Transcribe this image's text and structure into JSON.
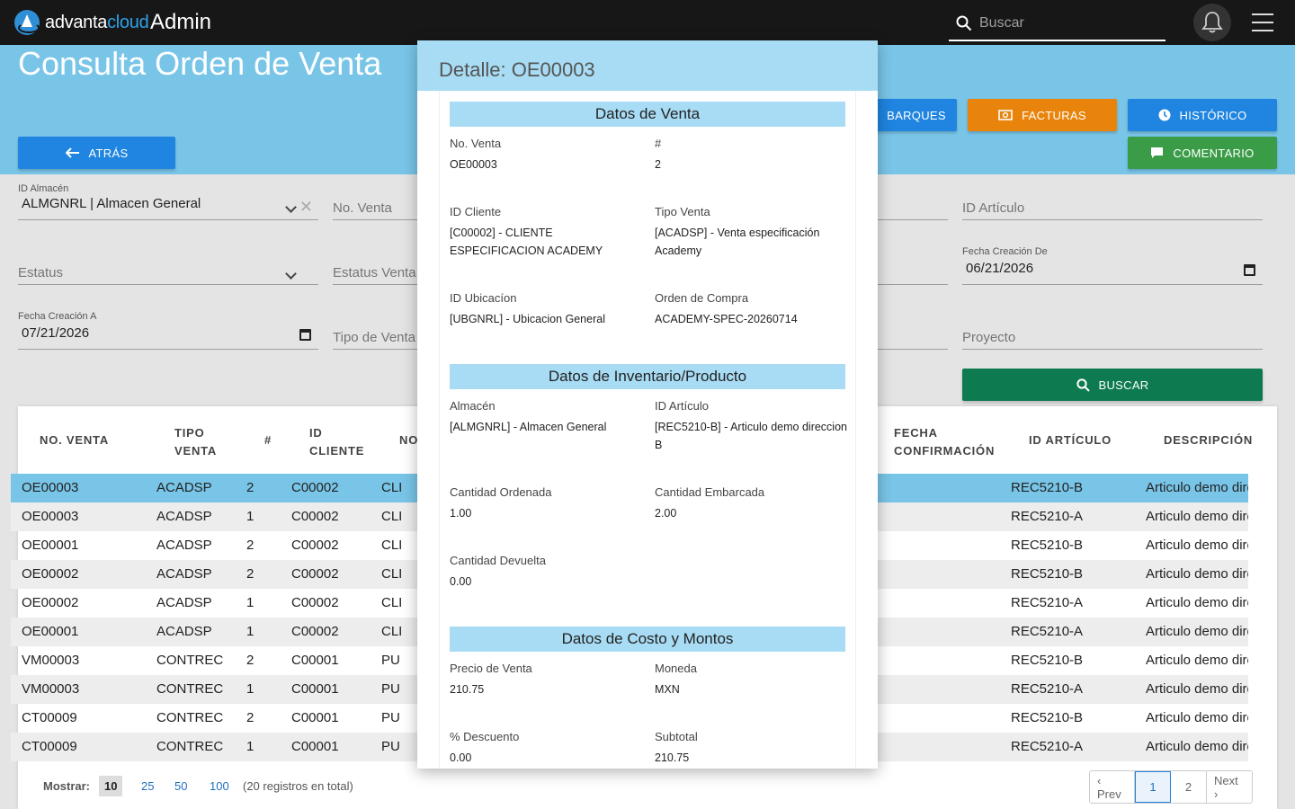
{
  "header": {
    "logo_a": "advanta",
    "logo_b": "cloud",
    "app": "Admin",
    "search_placeholder": "Buscar"
  },
  "page": {
    "title": "Consulta Orden de Venta",
    "back_label": "ATRÁS",
    "embarques_label": "BARQUES",
    "facturas_label": "FACTURAS",
    "historico_label": "HISTÓRICO",
    "comentario_label": "COMENTARIO",
    "buscar_label": "BUSCAR"
  },
  "filters": {
    "almacen_label": "ID Almacén",
    "almacen_value": "ALMGNRL | Almacen General",
    "no_venta": "No. Venta",
    "id_articulo": "ID Artículo",
    "estatus": "Estatus",
    "estatus_venta": "Estatus Venta",
    "fecha_de_label": "Fecha Creación De",
    "fecha_de_value": "06/21/2026",
    "fecha_a_label": "Fecha Creación A",
    "fecha_a_value": "07/21/2026",
    "tipo_venta": "Tipo de Venta",
    "proyecto": "Proyecto"
  },
  "table": {
    "headers": {
      "no_venta": "NO. VENTA",
      "tipo_1": "TIPO",
      "tipo_2": "VENTA",
      "num": "#",
      "cliente_1": "ID",
      "cliente_2": "CLIENTE",
      "no": "NO",
      "fecha_1": "FECHA",
      "fecha_2": "CONFIRMACIÓN",
      "articulo": "ID ARTÍCULO",
      "descripcion": "DESCRIPCIÓN"
    },
    "rows": [
      {
        "venta": "OE00003",
        "tipo": "ACADSP",
        "num": "2",
        "cliente": "C00002",
        "no": "CLI",
        "articulo": "REC5210-B",
        "desc": "Articulo demo direccion B"
      },
      {
        "venta": "OE00003",
        "tipo": "ACADSP",
        "num": "1",
        "cliente": "C00002",
        "no": "CLI",
        "articulo": "REC5210-A",
        "desc": "Articulo demo direccion A"
      },
      {
        "venta": "OE00001",
        "tipo": "ACADSP",
        "num": "2",
        "cliente": "C00002",
        "no": "CLI",
        "articulo": "REC5210-B",
        "desc": "Articulo demo direccion B"
      },
      {
        "venta": "OE00002",
        "tipo": "ACADSP",
        "num": "2",
        "cliente": "C00002",
        "no": "CLI",
        "articulo": "REC5210-B",
        "desc": "Articulo demo direccion B"
      },
      {
        "venta": "OE00002",
        "tipo": "ACADSP",
        "num": "1",
        "cliente": "C00002",
        "no": "CLI",
        "articulo": "REC5210-A",
        "desc": "Articulo demo direccion A"
      },
      {
        "venta": "OE00001",
        "tipo": "ACADSP",
        "num": "1",
        "cliente": "C00002",
        "no": "CLI",
        "articulo": "REC5210-A",
        "desc": "Articulo demo direccion A"
      },
      {
        "venta": "VM00003",
        "tipo": "CONTREC",
        "num": "2",
        "cliente": "C00001",
        "no": "PU",
        "articulo": "REC5210-B",
        "desc": "Articulo demo direccion B"
      },
      {
        "venta": "VM00003",
        "tipo": "CONTREC",
        "num": "1",
        "cliente": "C00001",
        "no": "PU",
        "articulo": "REC5210-A",
        "desc": "Articulo demo direccion A"
      },
      {
        "venta": "CT00009",
        "tipo": "CONTREC",
        "num": "2",
        "cliente": "C00001",
        "no": "PU",
        "articulo": "REC5210-B",
        "desc": "Articulo demo direccion B"
      },
      {
        "venta": "CT00009",
        "tipo": "CONTREC",
        "num": "1",
        "cliente": "C00001",
        "no": "PU",
        "articulo": "REC5210-A",
        "desc": "Articulo demo direccion A"
      }
    ],
    "footer": {
      "mostrar": "Mostrar:",
      "sizes": [
        "10",
        "25",
        "50",
        "100"
      ],
      "total": "(20 registros en total)",
      "prev": "‹ Prev",
      "pages": [
        "1",
        "2"
      ],
      "next": "Next ›"
    }
  },
  "modal": {
    "title": "Detalle: OE00003",
    "sec_venta": "Datos de Venta",
    "no_venta_lbl": "No. Venta",
    "no_venta_val": "OE00003",
    "num_lbl": "#",
    "num_val": "2",
    "cliente_lbl": "ID Cliente",
    "cliente_val": "[C00002] - CLIENTE ESPECIFICACION ACADEMY",
    "tipo_lbl": "Tipo Venta",
    "tipo_val": "[ACADSP] - Venta especificación Academy",
    "ubic_lbl": "ID Ubicacíon",
    "ubic_val": "[UBGNRL] - Ubicacion General",
    "oc_lbl": "Orden de Compra",
    "oc_val": "ACADEMY-SPEC-20260714",
    "sec_inv": "Datos de Inventario/Producto",
    "alm_lbl": "Almacén",
    "alm_val": "[ALMGNRL] - Almacen General",
    "art_lbl": "ID Artículo",
    "art_val": "[REC5210-B] - Articulo demo direccion B",
    "cant_ord_lbl": "Cantidad Ordenada",
    "cant_ord_val": "1.00",
    "cant_emb_lbl": "Cantidad Embarcada",
    "cant_emb_val": "2.00",
    "cant_dev_lbl": "Cantidad Devuelta",
    "cant_dev_val": "0.00",
    "sec_costo": "Datos de Costo y Montos",
    "precio_lbl": "Precio de Venta",
    "precio_val": "210.75",
    "moneda_lbl": "Moneda",
    "moneda_val": "MXN",
    "desc_lbl": "% Descuento",
    "desc_val": "0.00",
    "subtotal_lbl": "Subtotal",
    "subtotal_val": "210.75"
  }
}
